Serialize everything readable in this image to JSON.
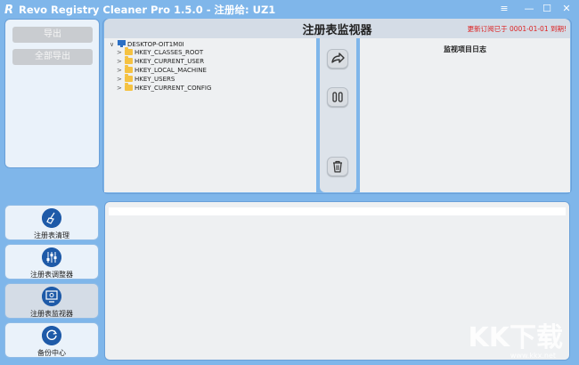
{
  "window": {
    "title": "Revo Registry Cleaner Pro 1.5.0 - 注册给: UZ1",
    "controls": [
      "≡",
      "—",
      "☐",
      "✕"
    ]
  },
  "export": {
    "export_label": "导出",
    "export_all_label": "全部导出"
  },
  "header": {
    "title": "注册表监视器",
    "notice": "更新订阅已于 0001-01-01 到期!"
  },
  "tree": {
    "root": "DESKTOP-OIT1M0I",
    "items": [
      "HKEY_CLASSES_ROOT",
      "HKEY_CURRENT_USER",
      "HKEY_LOCAL_MACHINE",
      "HKEY_USERS",
      "HKEY_CURRENT_CONFIG"
    ]
  },
  "actions": {
    "icons": [
      "share-arrow-icon",
      "pause-icon",
      "trash-icon"
    ]
  },
  "log": {
    "title": "监视项目日志"
  },
  "nav": {
    "items": [
      {
        "label": "注册表清理",
        "icon": "broom-icon"
      },
      {
        "label": "注册表调整器",
        "icon": "sliders-icon"
      },
      {
        "label": "注册表监视器",
        "icon": "monitor-icon",
        "active": true
      },
      {
        "label": "备份中心",
        "icon": "backup-icon"
      }
    ]
  },
  "watermark": {
    "brand": "KK下载",
    "url": "www.kkx.net"
  },
  "colors": {
    "background": "#7fb6ea",
    "accent": "#1e5aa8",
    "notice": "#dd2222"
  }
}
